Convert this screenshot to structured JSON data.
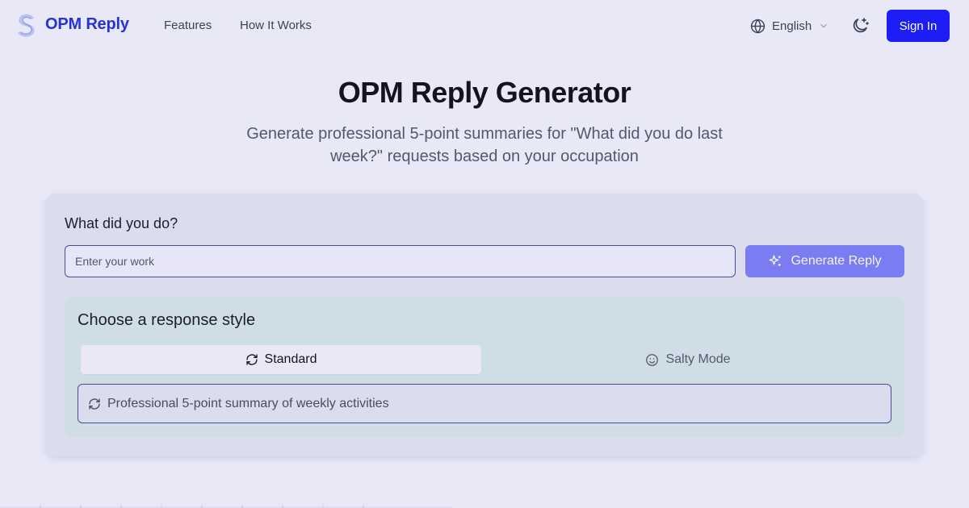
{
  "header": {
    "brand": "OPM Reply",
    "nav": [
      {
        "label": "Features"
      },
      {
        "label": "How It Works"
      }
    ],
    "language": "English",
    "signin_label": "Sign In"
  },
  "hero": {
    "title": "OPM Reply Generator",
    "subtitle": "Generate professional 5-point summaries for \"What did you do last week?\" requests based on your occupation"
  },
  "form": {
    "label": "What did you do?",
    "input_placeholder": "Enter your work",
    "input_value": "",
    "generate_label": "Generate Reply"
  },
  "style": {
    "title": "Choose a response style",
    "tabs": [
      {
        "label": "Standard",
        "icon": "refresh-icon",
        "selected": true
      },
      {
        "label": "Salty Mode",
        "icon": "smile-icon",
        "selected": false
      }
    ],
    "description": "Professional 5-point summary of weekly activities"
  },
  "colors": {
    "background": "#e8e8f7",
    "brand": "#2533d6",
    "primary_button": "#1d1df5",
    "generate_button": "#7c7cf2",
    "style_panel": "#cfdee6"
  }
}
